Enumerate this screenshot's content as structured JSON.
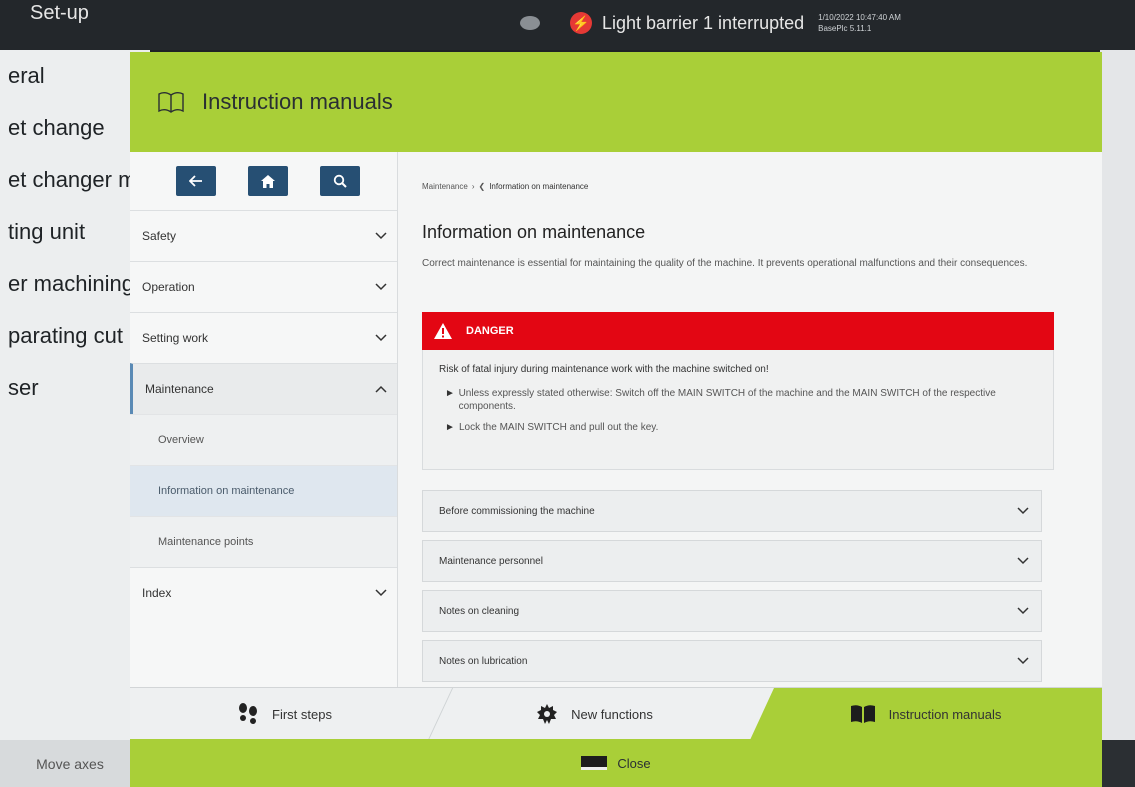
{
  "topbar": {
    "setup_label": "Set-up",
    "alert_text": "Light barrier 1 interrupted",
    "datetime": "1/10/2022 10:47:40 AM",
    "version": "BasePlc 5.11.1"
  },
  "background_menu": {
    "items": [
      "eral",
      "et change",
      "et changer m",
      "ting unit",
      "er machining",
      "parating cut",
      "ser"
    ],
    "move_axes": "Move axes"
  },
  "modal": {
    "title": "Instruction manuals",
    "nav": {
      "items": [
        {
          "label": "Safety"
        },
        {
          "label": "Operation"
        },
        {
          "label": "Setting work"
        },
        {
          "label": "Maintenance"
        }
      ],
      "subitems": [
        {
          "label": "Overview"
        },
        {
          "label": "Information on maintenance"
        },
        {
          "label": "Maintenance points"
        }
      ],
      "index_label": "Index"
    },
    "breadcrumb": {
      "parent": "Maintenance",
      "current": "Information on maintenance"
    },
    "content": {
      "heading": "Information on maintenance",
      "intro": "Correct maintenance is essential for maintaining the quality of the machine. It prevents operational malfunctions and their consequences.",
      "danger": {
        "label": "DANGER",
        "risk": "Risk of fatal injury during maintenance work with the machine switched on!",
        "bullets": [
          "Unless expressly stated otherwise: Switch off the MAIN SWITCH of the machine and the MAIN SWITCH of the respective components.",
          "Lock the MAIN SWITCH and pull out the key."
        ]
      },
      "accordions": [
        {
          "label": "Before commissioning the machine"
        },
        {
          "label": "Maintenance personnel"
        },
        {
          "label": "Notes on cleaning"
        },
        {
          "label": "Notes on lubrication"
        }
      ]
    },
    "tabs": {
      "first_steps": "First steps",
      "new_functions": "New functions",
      "instruction_manuals": "Instruction manuals"
    },
    "close_label": "Close"
  },
  "colors": {
    "accent_green": "#a9cf38",
    "danger_red": "#e30613",
    "toolbar_blue": "#264f73"
  },
  "icons": {
    "header": "book-open-icon",
    "back": "arrow-left-icon",
    "home": "home-icon",
    "search": "search-icon",
    "first_steps": "footsteps-icon",
    "new_functions": "gear-icon",
    "instruction_manuals": "book-icon",
    "close": "close-icon"
  }
}
